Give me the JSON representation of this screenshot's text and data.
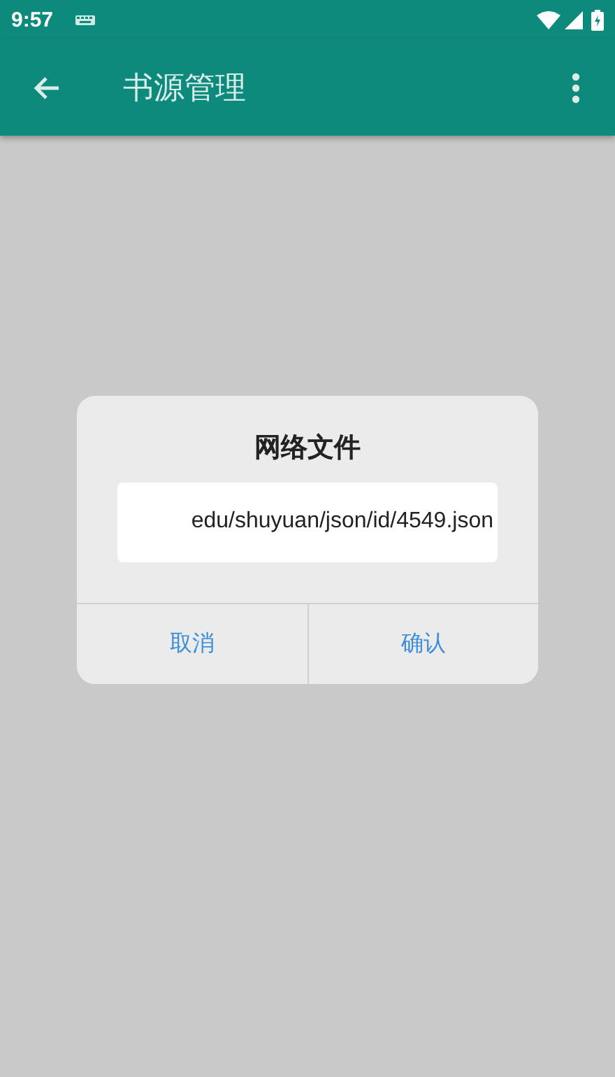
{
  "status_bar": {
    "time": "9:57"
  },
  "app_bar": {
    "title": "书源管理"
  },
  "dialog": {
    "title": "网络文件",
    "field": {
      "value": "edu/shuyuan/json/id/4549.json"
    },
    "buttons": [
      {
        "label": "取消"
      },
      {
        "label": "确认"
      }
    ]
  }
}
